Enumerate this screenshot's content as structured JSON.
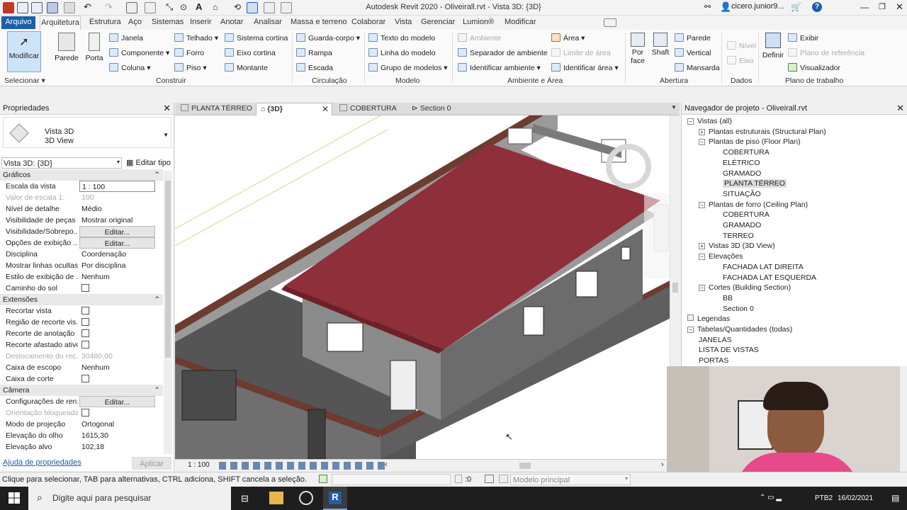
{
  "window": {
    "title": "Autodesk Revit 2020 - Oliveirall.rvt - Vista 3D: {3D}",
    "user": "cicero.junior9...",
    "help": "?"
  },
  "ribbon_tabs": [
    "Arquivo",
    "Arquitetura",
    "Estrutura",
    "Aço",
    "Sistemas",
    "Inserir",
    "Anotar",
    "Analisar",
    "Massa e terreno",
    "Colaborar",
    "Vista",
    "Gerenciar",
    "Lumion®",
    "Modificar"
  ],
  "ribbon": {
    "modificar": "Modificar",
    "parede": "Parede",
    "porta": "Porta",
    "janela": "Janela",
    "componente": "Componente",
    "coluna": "Coluna",
    "telhado": "Telhado",
    "forro": "Forro",
    "piso": "Piso",
    "sistema_cortina": "Sistema cortina",
    "eixo_cortina": "Eixo cortina",
    "montante": "Montante",
    "guarda_corpo": "Guarda-corpo",
    "rampa": "Rampa",
    "escada": "Escada",
    "texto_modelo": "Texto do modelo",
    "linha_modelo": "Linha do modelo",
    "grupo_modelos": "Grupo de modelos",
    "ambiente": "Ambiente",
    "separador_ambiente": "Separador de ambiente",
    "identificar_ambiente": "Identificar ambiente",
    "area": "Área",
    "limite_area": "Limite de área",
    "identificar_area": "Identificar área",
    "por_face": "Por face",
    "shaft": "Shaft",
    "parede_ab": "Parede",
    "vertical": "Vertical",
    "mansarda": "Mansarda",
    "nivel": "Nível",
    "eixo": "Eixo",
    "definir": "Definir",
    "exibir": "Exibir",
    "plano_referencia": "Plano de referência",
    "visualizador": "Visualizador",
    "groups": {
      "selecionar": "Selecionar",
      "construir": "Construir",
      "circulacao": "Circulação",
      "modelo": "Modelo",
      "ambiente_area": "Ambiente e Área",
      "abertura": "Abertura",
      "dados": "Dados",
      "plano_trabalho": "Plano de trabalho"
    }
  },
  "properties": {
    "title": "Propriedades",
    "type_name": "Vista 3D",
    "type_sub": "3D View",
    "selector": "Vista 3D: {3D}",
    "edit_type": "Editar tipo",
    "sections": {
      "graficos": "Gráficos",
      "extensoes": "Extensões",
      "camera": "Câmera"
    },
    "rows_graficos": [
      {
        "label": "Escala da vista",
        "value": "1 : 100"
      },
      {
        "label": "Valor de escala    1:",
        "value": "100"
      },
      {
        "label": "Nível de detalhe",
        "value": "Médio"
      },
      {
        "label": "Visibilidade de peças",
        "value": "Mostrar original"
      },
      {
        "label": "Visibilidade/Sobrepo...",
        "value": "Editar..."
      },
      {
        "label": "Opções de exibição ...",
        "value": "Editar..."
      },
      {
        "label": "Disciplina",
        "value": "Coordenação"
      },
      {
        "label": "Mostrar linhas ocultas",
        "value": "Por disciplina"
      },
      {
        "label": "Estilo de exibição de ...",
        "value": "Nenhum"
      },
      {
        "label": "Caminho do sol",
        "value": ""
      }
    ],
    "rows_extensoes": [
      {
        "label": "Recortar vista",
        "value": ""
      },
      {
        "label": "Região de recorte vis...",
        "value": ""
      },
      {
        "label": "Recorte de anotação",
        "value": ""
      },
      {
        "label": "Recorte afastado ativo",
        "value": ""
      },
      {
        "label": "Deslocamento do rec...",
        "value": "30480,00"
      },
      {
        "label": "Caixa de escopo",
        "value": "Nenhum"
      },
      {
        "label": "Caixa de corte",
        "value": ""
      }
    ],
    "rows_camera": [
      {
        "label": "Configurações de ren...",
        "value": "Editar..."
      },
      {
        "label": "Orientação bloqueada",
        "value": ""
      },
      {
        "label": "Modo de projeção",
        "value": "Ortogonal"
      },
      {
        "label": "Elevação do olho",
        "value": "1615,30"
      },
      {
        "label": "Elevação alvo",
        "value": "102,18"
      }
    ],
    "help_link": "Ajuda de propriedades",
    "apply": "Aplicar"
  },
  "view_tabs": [
    "PLANTA TÉRREO",
    "{3D}",
    "COBERTURA",
    "Section 0"
  ],
  "view_scale": "1 : 100",
  "navigator": {
    "title": "Navegador de projeto - Oliveirall.rvt",
    "tree": [
      {
        "label": "Vistas (all)",
        "level": 0,
        "tog": "-"
      },
      {
        "label": "Plantas estruturais (Structural Plan)",
        "level": 1,
        "tog": "+"
      },
      {
        "label": "Plantas de piso (Floor Plan)",
        "level": 1,
        "tog": "-"
      },
      {
        "label": "COBERTURA",
        "level": 2
      },
      {
        "label": "ELÉTRICO",
        "level": 2
      },
      {
        "label": "GRAMADO",
        "level": 2
      },
      {
        "label": "PLANTA TÉRREO",
        "level": 2,
        "selected": true
      },
      {
        "label": "SITUAÇÃO",
        "level": 2
      },
      {
        "label": "Plantas de forro (Ceiling Plan)",
        "level": 1,
        "tog": "-"
      },
      {
        "label": "COBERTURA",
        "level": 2
      },
      {
        "label": "GRAMADO",
        "level": 2
      },
      {
        "label": "TERREO",
        "level": 2
      },
      {
        "label": "Vistas 3D (3D View)",
        "level": 1,
        "tog": "+"
      },
      {
        "label": "Elevações",
        "level": 1,
        "tog": "-"
      },
      {
        "label": "FACHADA LAT DIREITA",
        "level": 2
      },
      {
        "label": "FACHADA LAT ESQUERDA",
        "level": 2
      },
      {
        "label": "Cortes (Building Section)",
        "level": 1,
        "tog": "-"
      },
      {
        "label": "BB",
        "level": 2
      },
      {
        "label": "Section 0",
        "level": 2
      },
      {
        "label": "Legendas",
        "level": 0,
        "tog": ""
      },
      {
        "label": "Tabelas/Quantidades (todas)",
        "level": 0,
        "tog": "-"
      },
      {
        "label": "JANELAS",
        "level": 1
      },
      {
        "label": "LISTA DE VISTAS",
        "level": 1
      },
      {
        "label": "PORTAS",
        "level": 1
      }
    ]
  },
  "status": {
    "hint": "Clique para selecionar, TAB para alternativas, CTRL adiciona, SHIFT cancela a seleção.",
    "zero": ":0",
    "model": "Modelo principal"
  },
  "taskbar": {
    "search": "Digite aqui para pesquisar",
    "lang": "PTB2",
    "date": "16/02/2021"
  },
  "colors": {
    "roof": "#8e2f3a",
    "wall": "#7d7d7d",
    "accent": "#1f5ea8"
  }
}
